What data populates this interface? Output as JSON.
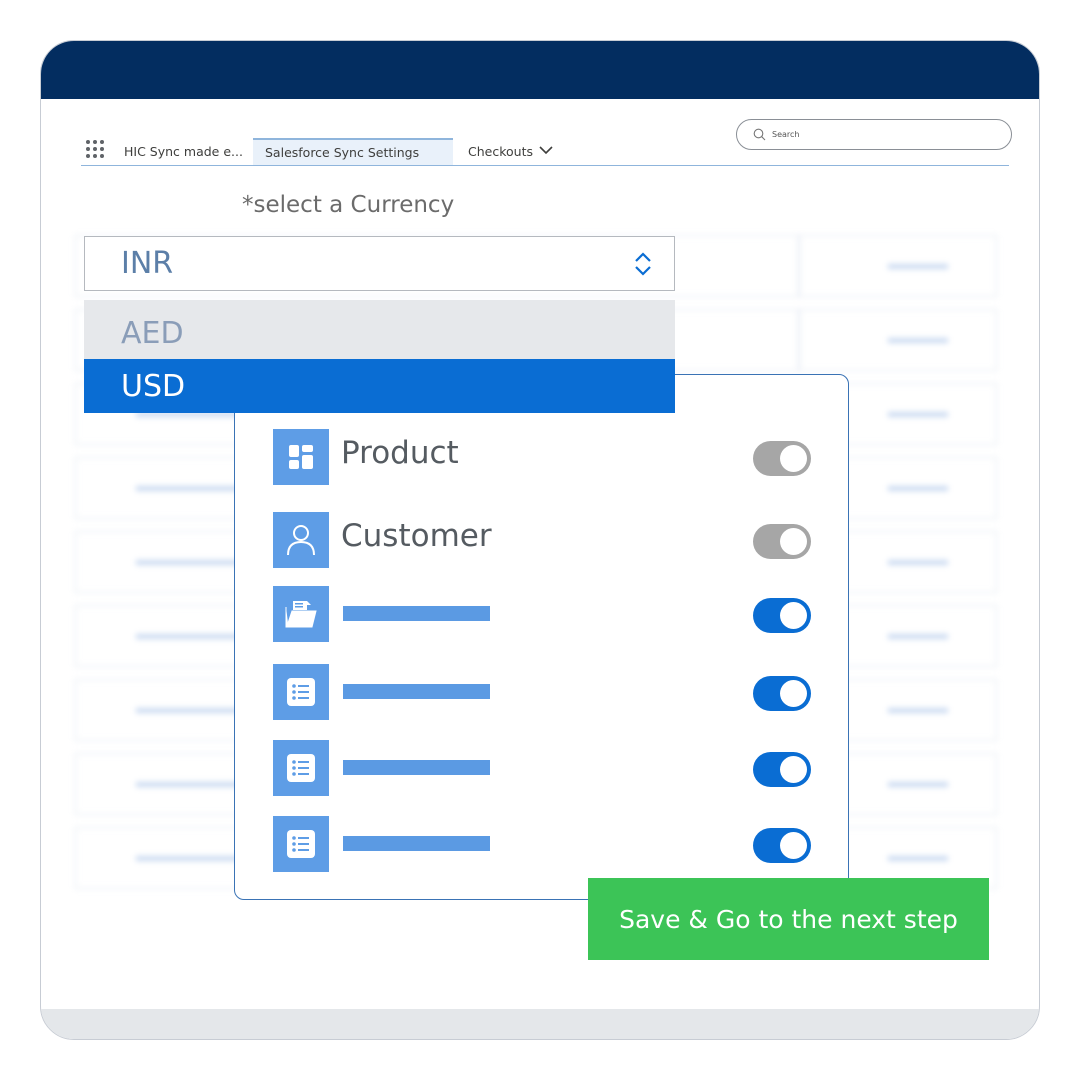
{
  "nav": {
    "app_name": "HIC Sync made e...",
    "tabs": [
      {
        "label": "Salesforce Sync Settings",
        "active": true
      },
      {
        "label": "Checkouts",
        "active": false
      }
    ],
    "search_placeholder": "Search"
  },
  "currency": {
    "label": "*select a Currency",
    "selected": "INR",
    "options": [
      {
        "label": "AED",
        "highlighted": false
      },
      {
        "label": "USD",
        "highlighted": true
      }
    ]
  },
  "sync_items": [
    {
      "label": "Product",
      "icon": "product-icon",
      "enabled": false
    },
    {
      "label": "Customer",
      "icon": "person-icon",
      "enabled": false
    },
    {
      "label": "",
      "icon": "folder-icon",
      "enabled": true
    },
    {
      "label": "",
      "icon": "list-icon",
      "enabled": true
    },
    {
      "label": "",
      "icon": "list-icon",
      "enabled": true
    },
    {
      "label": "",
      "icon": "list-icon",
      "enabled": true
    }
  ],
  "save_button": "Save & Go to the next step",
  "colors": {
    "header": "#032d60",
    "accent": "#0a6dd3",
    "icon_bg": "#5e9de6",
    "save": "#3cc457",
    "toggle_off": "#a6a6a6"
  }
}
